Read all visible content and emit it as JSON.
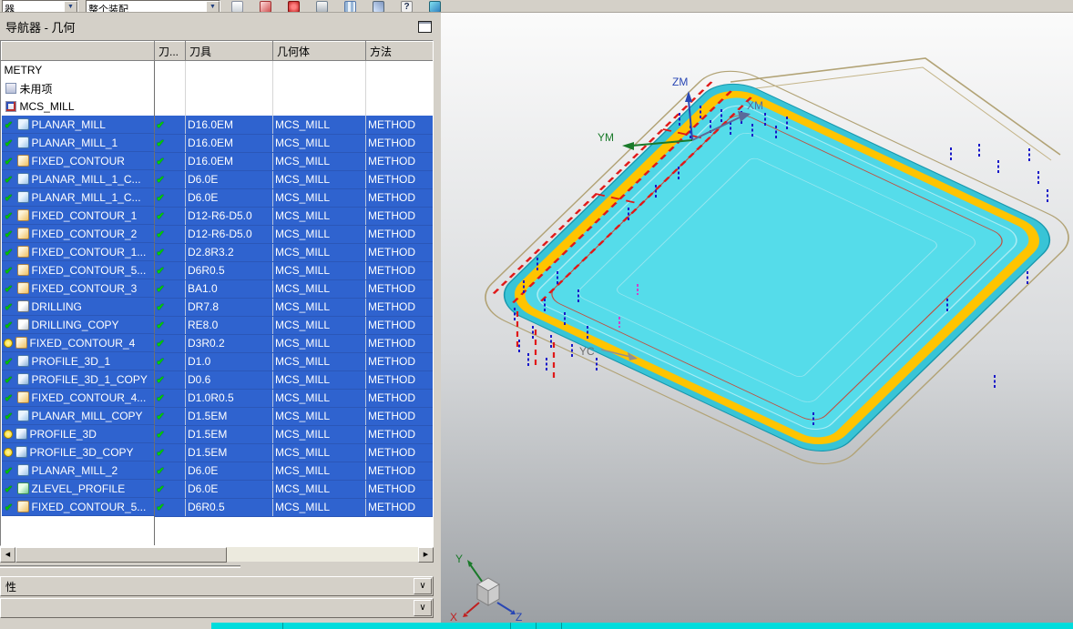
{
  "toolbar": {
    "filter_combo": "器",
    "scope_combo": "整个装配"
  },
  "panel": {
    "title": "导航器 - 几何",
    "columns": [
      "",
      "刀...",
      "刀具",
      "几何体",
      "方法"
    ],
    "tree_rows": [
      {
        "name": "METRY"
      },
      {
        "name": "未用项"
      },
      {
        "name": "MCS_MILL"
      }
    ],
    "operations": [
      {
        "name": "PLANAR_MILL",
        "tool": "D16.0EM",
        "geometry": "MCS_MILL",
        "method": "METHOD",
        "status": "check",
        "type": "planar"
      },
      {
        "name": "PLANAR_MILL_1",
        "tool": "D16.0EM",
        "geometry": "MCS_MILL",
        "method": "METHOD",
        "status": "check",
        "type": "planar"
      },
      {
        "name": "FIXED_CONTOUR",
        "tool": "D16.0EM",
        "geometry": "MCS_MILL",
        "method": "METHOD",
        "status": "check",
        "type": "contour"
      },
      {
        "name": "PLANAR_MILL_1_C...",
        "tool": "D6.0E",
        "geometry": "MCS_MILL",
        "method": "METHOD",
        "status": "check",
        "type": "planar"
      },
      {
        "name": "PLANAR_MILL_1_C...",
        "tool": "D6.0E",
        "geometry": "MCS_MILL",
        "method": "METHOD",
        "status": "check",
        "type": "planar"
      },
      {
        "name": "FIXED_CONTOUR_1",
        "tool": "D12-R6-D5.0",
        "geometry": "MCS_MILL",
        "method": "METHOD",
        "status": "check",
        "type": "contour"
      },
      {
        "name": "FIXED_CONTOUR_2",
        "tool": "D12-R6-D5.0",
        "geometry": "MCS_MILL",
        "method": "METHOD",
        "status": "check",
        "type": "contour"
      },
      {
        "name": "FIXED_CONTOUR_1...",
        "tool": "D2.8R3.2",
        "geometry": "MCS_MILL",
        "method": "METHOD",
        "status": "check",
        "type": "contour"
      },
      {
        "name": "FIXED_CONTOUR_5...",
        "tool": "D6R0.5",
        "geometry": "MCS_MILL",
        "method": "METHOD",
        "status": "check",
        "type": "contour"
      },
      {
        "name": "FIXED_CONTOUR_3",
        "tool": "BA1.0",
        "geometry": "MCS_MILL",
        "method": "METHOD",
        "status": "check",
        "type": "contour"
      },
      {
        "name": "DRILLING",
        "tool": "DR7.8",
        "geometry": "MCS_MILL",
        "method": "METHOD",
        "status": "check",
        "type": "drill"
      },
      {
        "name": "DRILLING_COPY",
        "tool": "RE8.0",
        "geometry": "MCS_MILL",
        "method": "METHOD",
        "status": "check",
        "type": "drill"
      },
      {
        "name": "FIXED_CONTOUR_4",
        "tool": "D3R0.2",
        "geometry": "MCS_MILL",
        "method": "METHOD",
        "status": "bulb",
        "type": "contour"
      },
      {
        "name": "PROFILE_3D_1",
        "tool": "D1.0",
        "geometry": "MCS_MILL",
        "method": "METHOD",
        "status": "check",
        "type": "profile"
      },
      {
        "name": "PROFILE_3D_1_COPY",
        "tool": "D0.6",
        "geometry": "MCS_MILL",
        "method": "METHOD",
        "status": "check",
        "type": "profile"
      },
      {
        "name": "FIXED_CONTOUR_4...",
        "tool": "D1.0R0.5",
        "geometry": "MCS_MILL",
        "method": "METHOD",
        "status": "check",
        "type": "contour"
      },
      {
        "name": "PLANAR_MILL_COPY",
        "tool": "D1.5EM",
        "geometry": "MCS_MILL",
        "method": "METHOD",
        "status": "check",
        "type": "planar"
      },
      {
        "name": "PROFILE_3D",
        "tool": "D1.5EM",
        "geometry": "MCS_MILL",
        "method": "METHOD",
        "status": "bulb",
        "type": "profile"
      },
      {
        "name": "PROFILE_3D_COPY",
        "tool": "D1.5EM",
        "geometry": "MCS_MILL",
        "method": "METHOD",
        "status": "bulb",
        "type": "profile"
      },
      {
        "name": "PLANAR_MILL_2",
        "tool": "D6.0E",
        "geometry": "MCS_MILL",
        "method": "METHOD",
        "status": "check",
        "type": "planar"
      },
      {
        "name": "ZLEVEL_PROFILE",
        "tool": "D6.0E",
        "geometry": "MCS_MILL",
        "method": "METHOD",
        "status": "check",
        "type": "zlevel"
      },
      {
        "name": "FIXED_CONTOUR_5...",
        "tool": "D6R0.5",
        "geometry": "MCS_MILL",
        "method": "METHOD",
        "status": "check",
        "type": "contour"
      }
    ],
    "properties_label": "性",
    "details_label": ""
  },
  "viewport": {
    "axis_labels": {
      "zm": "ZM",
      "xm": "XM",
      "ym": "YM",
      "yc": "YC"
    },
    "triad_labels": {
      "x": "X",
      "y": "Y",
      "z": "Z"
    }
  },
  "icons": {
    "check": "✔",
    "bulb": "●",
    "scroll_left": "◀",
    "scroll_right": "▶",
    "collapse": "∨",
    "combo_arrow": "▼"
  },
  "colors": {
    "selection_blue": "#2f63cf",
    "part_cyan": "#4fd6e6",
    "rim_yellow": "#ffc400",
    "toolpath_red": "#e01818",
    "drill_mark_blue": "#1818c8",
    "stock_tan": "#b2a376",
    "status_bar_cyan": "#00dcdc",
    "panel_gray": "#d4d0c8"
  }
}
